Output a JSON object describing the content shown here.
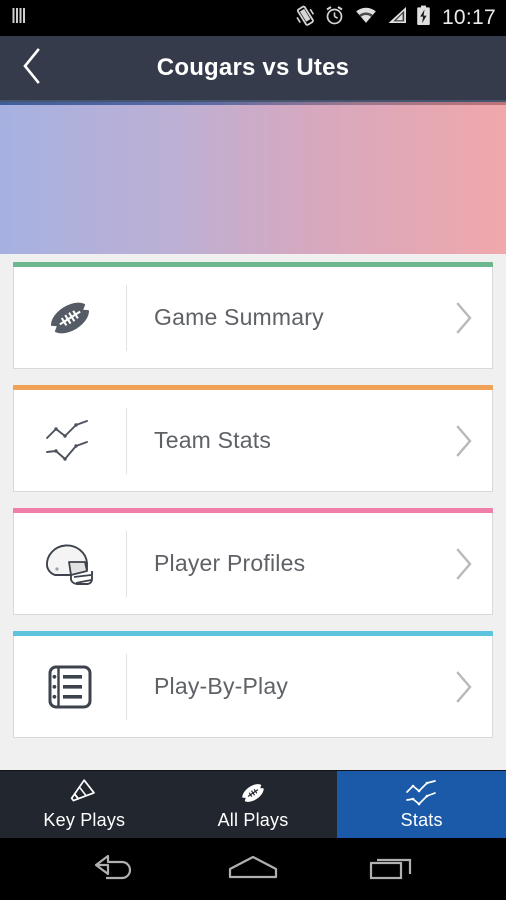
{
  "status_bar": {
    "time": "10:17",
    "icons": [
      {
        "name": "sim-signal-bars-icon",
        "position": "left"
      },
      {
        "name": "vibrate-icon",
        "position": "right"
      },
      {
        "name": "alarm-clock-icon",
        "position": "right"
      },
      {
        "name": "wifi-icon",
        "position": "right"
      },
      {
        "name": "cellular-signal-icon",
        "position": "right"
      },
      {
        "name": "battery-charging-icon",
        "position": "right"
      }
    ]
  },
  "header": {
    "title": "Cougars vs Utes",
    "back_icon": "chevron-left-icon",
    "background_color": "#353b4a",
    "title_color": "#ffffff"
  },
  "hero": {
    "gradient_start_color": "#a6b1e1",
    "gradient_end_color": "#f0a8ab"
  },
  "menu": {
    "items": [
      {
        "label": "Game Summary",
        "icon": "football-icon",
        "accent_color": "#6cb78e",
        "chevron_icon": "chevron-right-icon"
      },
      {
        "label": "Team Stats",
        "icon": "line-chart-icon",
        "accent_color": "#f0a259",
        "chevron_icon": "chevron-right-icon"
      },
      {
        "label": "Player Profiles",
        "icon": "football-helmet-icon",
        "accent_color": "#ef7fa8",
        "chevron_icon": "chevron-right-icon"
      },
      {
        "label": "Play-By-Play",
        "icon": "list-document-icon",
        "accent_color": "#5ec3dc",
        "chevron_icon": "chevron-right-icon"
      }
    ]
  },
  "tabs": {
    "active_color": "#1b5aa8",
    "inactive_color": "#22262f",
    "items": [
      {
        "label": "Key Plays",
        "icon": "megaphone-icon",
        "active": false
      },
      {
        "label": "All Plays",
        "icon": "football-icon",
        "active": false
      },
      {
        "label": "Stats",
        "icon": "line-chart-icon",
        "active": true
      }
    ]
  },
  "android_nav": {
    "buttons": [
      {
        "name": "back-icon"
      },
      {
        "name": "home-icon"
      },
      {
        "name": "recents-icon"
      }
    ]
  }
}
